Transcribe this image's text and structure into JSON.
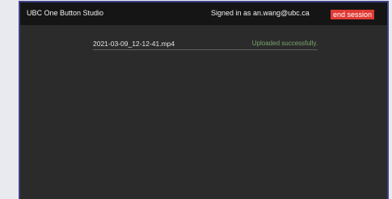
{
  "header": {
    "app_title": "UBC One Button Studio",
    "signed_in_prefix": "Signed in as ",
    "user_email": "an.wang@ubc.ca",
    "end_session_label": "end session"
  },
  "uploads": [
    {
      "file_name": "2021-03-09_12-12-41.mp4",
      "status": "Uploaded successfully."
    }
  ],
  "colors": {
    "window_border": "#3f4187",
    "header_background": "#151515",
    "content_background": "#2b2b2b",
    "end_session_background": "#e03a34",
    "success_text": "#79a56a"
  }
}
